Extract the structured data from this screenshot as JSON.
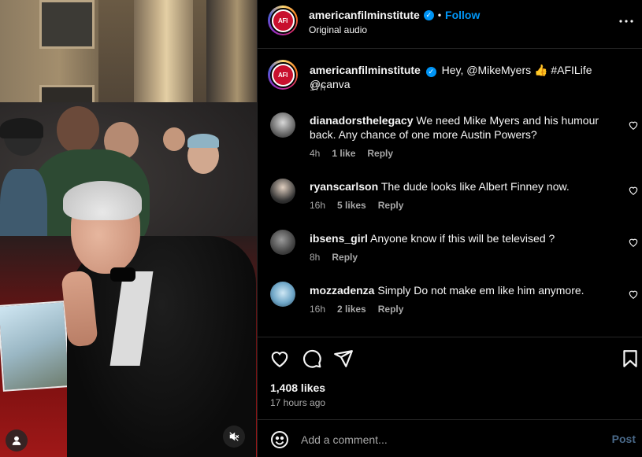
{
  "header": {
    "username": "americanfilminstitute",
    "separator": "•",
    "follow_label": "Follow",
    "audio_label": "Original audio",
    "avatar_text": "AFI"
  },
  "caption": {
    "username": "americanfilminstitute",
    "text": "Hey, @MikeMyers 👍 #AFILife @canva",
    "time": "17h",
    "avatar_text": "AFI"
  },
  "comments": [
    {
      "username": "dianadorsthelegacy",
      "text": "We need Mike Myers and his humour back. Any chance of one more Austin Powers?",
      "time": "4h",
      "likes": "1 like",
      "reply": "Reply"
    },
    {
      "username": "ryanscarlson",
      "text": "The dude looks like Albert Finney now.",
      "time": "16h",
      "likes": "5 likes",
      "reply": "Reply"
    },
    {
      "username": "ibsens_girl",
      "text": "Anyone know if this will be televised ?",
      "time": "8h",
      "likes": "",
      "reply": "Reply"
    },
    {
      "username": "mozzadenza",
      "text": "Simply Do not make em like him anymore.",
      "time": "16h",
      "likes": "2 likes",
      "reply": "Reply"
    }
  ],
  "post": {
    "likes": "1,408 likes",
    "time_ago": "17 hours ago"
  },
  "add_comment": {
    "placeholder": "Add a comment...",
    "post_label": "Post"
  },
  "colors": {
    "background": "#000000",
    "accent_blue": "#0095f6",
    "muted_text": "#a8a8a8",
    "divider": "#262626",
    "afi_red": "#c8102e"
  }
}
